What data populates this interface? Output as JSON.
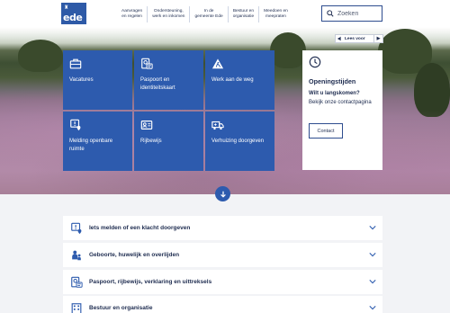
{
  "header": {
    "logo_text": "ede",
    "nav": [
      {
        "line1": "Aanvragen",
        "line2": "en regelen"
      },
      {
        "line1": "Ondersteuning,",
        "line2": "werk en inkomen"
      },
      {
        "line1": "In de",
        "line2": "gemeente Ede"
      },
      {
        "line1": "Bestuur en",
        "line2": "organisatie"
      },
      {
        "line1": "Meedoen en",
        "line2": "meepraten"
      }
    ],
    "search_placeholder": "Zoeken"
  },
  "readspeaker": {
    "label": "Lees voor"
  },
  "tiles": [
    {
      "label": "Vacatures",
      "icon": "briefcase-icon"
    },
    {
      "label": "Paspoort en identiteitskaart",
      "icon": "passport-icon"
    },
    {
      "label": "Werk aan de weg",
      "icon": "roadwork-icon"
    },
    {
      "label": "Melding openbare ruimte",
      "icon": "report-location-icon"
    },
    {
      "label": "Rijbewijs",
      "icon": "id-card-icon"
    },
    {
      "label": "Verhuizing doorgeven",
      "icon": "moving-truck-icon"
    }
  ],
  "opening": {
    "title": "Openingstijden",
    "question": "Wilt u langskomen?",
    "text": "Bekijk onze contactpagina",
    "button": "Contact"
  },
  "accordion": [
    {
      "label": "Iets melden of een klacht doorgeven",
      "icon": "report-icon"
    },
    {
      "label": "Geboorte, huwelijk en overlijden",
      "icon": "family-icon"
    },
    {
      "label": "Paspoort, rijbewijs, verklaring en uittreksels",
      "icon": "document-id-icon"
    },
    {
      "label": "Bestuur en organisatie",
      "icon": "building-icon"
    }
  ],
  "colors": {
    "brand_blue": "#2d5bae",
    "text_navy": "#1d2b4f",
    "list_bg": "#f2f3f6"
  }
}
